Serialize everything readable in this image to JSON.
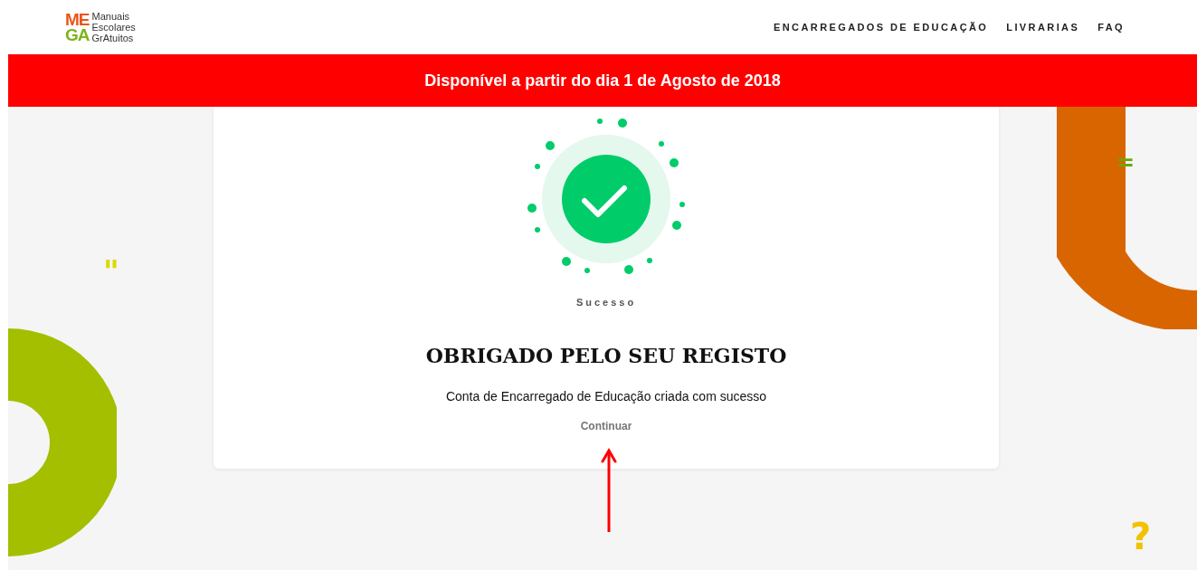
{
  "header": {
    "logo": {
      "letters_top": "ME",
      "letters_bottom": "GA",
      "lines": [
        "Manuais",
        "Escolares",
        "GrAtuitos"
      ]
    },
    "nav": [
      {
        "label": "ENCARREGADOS DE EDUCAÇÃO"
      },
      {
        "label": "LIVRARIAS"
      },
      {
        "label": "FAQ"
      }
    ]
  },
  "banner": {
    "text": "Disponível a partir do dia 1 de Agosto de 2018"
  },
  "decorations": [
    {
      "kind": "quote",
      "text": "\""
    },
    {
      "kind": "equals",
      "text": "="
    },
    {
      "kind": "question",
      "text": "?"
    }
  ],
  "card": {
    "status": "Sucesso",
    "title": "OBRIGADO PELO SEU REGISTO",
    "message": "Conta de Encarregado de Educação criada com sucesso",
    "link": "Continuar"
  }
}
